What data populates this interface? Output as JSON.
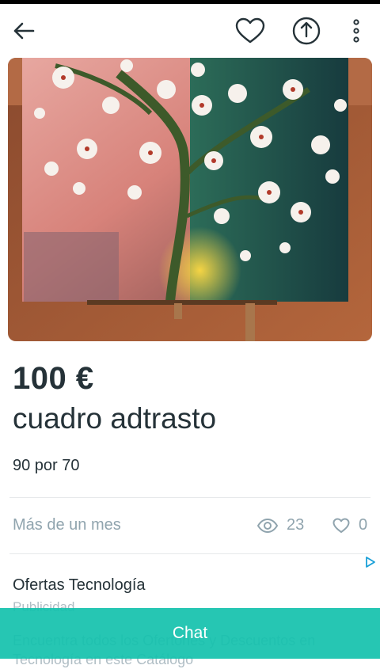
{
  "header": {
    "back_icon": "arrow-left-icon",
    "favorite_icon": "heart-icon",
    "share_icon": "share-icon",
    "more_icon": "more-vertical-icon"
  },
  "product": {
    "image_alt": "painting of blossoming tree on easel",
    "price": "100 €",
    "title": "cuadro adtrasto",
    "description": "90 por 70",
    "posted": "Más de un mes",
    "views": "23",
    "likes": "0"
  },
  "ad": {
    "title": "Ofertas Tecnología",
    "label": "Publicidad",
    "text": "Encuentra todos los Ofertones y Descuentos en Tecnología en este Catálogo"
  },
  "chat": {
    "label": "Chat"
  },
  "colors": {
    "accent": "#13c1ac",
    "text": "#253238",
    "muted": "#90a4ae"
  }
}
